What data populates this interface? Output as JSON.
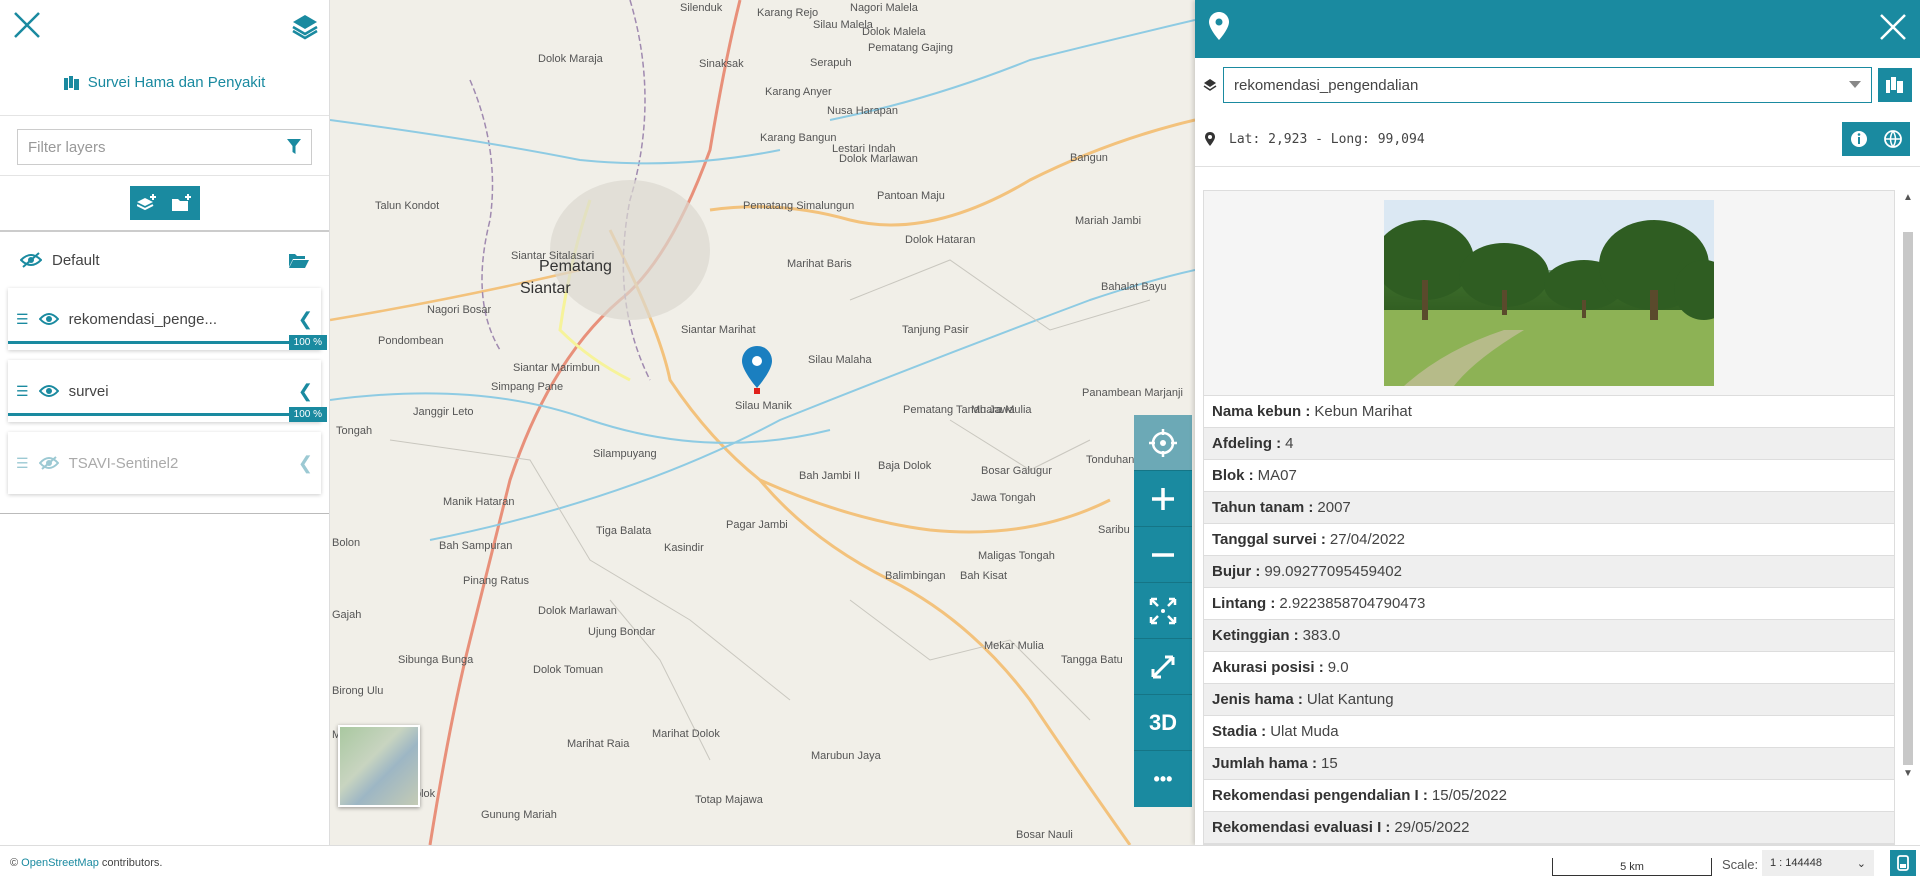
{
  "left_panel": {
    "title": "Survei Hama dan Penyakit",
    "filter_placeholder": "Filter layers",
    "group_name": "Default",
    "layers": [
      {
        "name": "rekomendasi_penge...",
        "opacity": "100 %",
        "visible": true
      },
      {
        "name": "survei",
        "opacity": "100 %",
        "visible": true
      },
      {
        "name": "TSAVI-Sentinel2",
        "visible": false
      }
    ]
  },
  "map": {
    "places": [
      {
        "name": "Silenduk"
      },
      {
        "name": "Karang Rejo"
      },
      {
        "name": "Silau Malela"
      },
      {
        "name": "Nagori Malela"
      },
      {
        "name": "Dolok Malela"
      },
      {
        "name": "Pematang Gajing"
      },
      {
        "name": "Dolok Maraja"
      },
      {
        "name": "Sinaksak"
      },
      {
        "name": "Serapuh"
      },
      {
        "name": "Karang Anyer"
      },
      {
        "name": "Nusa Harapan"
      },
      {
        "name": "Karang Bangun"
      },
      {
        "name": "Lestari Indah"
      },
      {
        "name": "Dolok Marlawan"
      },
      {
        "name": "Bangun"
      },
      {
        "name": "Pantoan Maju"
      },
      {
        "name": "Talun Kondot"
      },
      {
        "name": "Pematang Simalungun"
      },
      {
        "name": "Mariah Jambi"
      },
      {
        "name": "Siantar Sitalasari"
      },
      {
        "name": "Pematang"
      },
      {
        "name": "Siantar"
      },
      {
        "name": "Marihat Baris"
      },
      {
        "name": "Dolok Hataran"
      },
      {
        "name": "Nagori Bosar"
      },
      {
        "name": "Bahalat Bayu"
      },
      {
        "name": "Siantar Marihat"
      },
      {
        "name": "Tanjung Pasir"
      },
      {
        "name": "Pondombean"
      },
      {
        "name": "Silau Malaha"
      },
      {
        "name": "Panambean Marjanji"
      },
      {
        "name": "Siantar Marimbun"
      },
      {
        "name": "Simpang Pane"
      },
      {
        "name": "Silau Manik"
      },
      {
        "name": "Janggir Leto"
      },
      {
        "name": "Pematang Tanah Jawa"
      },
      {
        "name": "Muara Mulia"
      },
      {
        "name": "Tonduhan"
      },
      {
        "name": "Silampuyang"
      },
      {
        "name": "Baja Dolok"
      },
      {
        "name": "Bosar Galugur"
      },
      {
        "name": "Bah Jambi II"
      },
      {
        "name": "Manik Hataran"
      },
      {
        "name": "Jawa Tongah"
      },
      {
        "name": "Tiga Balata"
      },
      {
        "name": "Pagar Jambi"
      },
      {
        "name": "Saribu"
      },
      {
        "name": "Bah Sampuran"
      },
      {
        "name": "Kasindir"
      },
      {
        "name": "Maligas Tongah"
      },
      {
        "name": "Balimbingan"
      },
      {
        "name": "Bah Kisat"
      },
      {
        "name": "Pinang Ratus"
      },
      {
        "name": "Dolok Marlawan"
      },
      {
        "name": "Ujung Bondar"
      },
      {
        "name": "Sibunga Bunga"
      },
      {
        "name": "Dolok Tomuan"
      },
      {
        "name": "Mekar Mulia"
      },
      {
        "name": "Tangga Batu"
      },
      {
        "name": "Marihat Raia"
      },
      {
        "name": "Marihat Dolok"
      },
      {
        "name": "Marubun Jaya"
      },
      {
        "name": "Totap Majawa"
      },
      {
        "name": "Gunung Mariah"
      },
      {
        "name": "Bosar Nauli"
      },
      {
        "name": "Tongah"
      },
      {
        "name": "Bolon"
      },
      {
        "name": "Gajah"
      },
      {
        "name": "Birong Ulu"
      },
      {
        "name": "olok"
      },
      {
        "name": "Marimbun"
      }
    ],
    "controls": [
      "locate",
      "zoom-in",
      "zoom-out",
      "fit",
      "fullscreen",
      "3D",
      "more"
    ],
    "control_3d_label": "3D",
    "more_label": "•••"
  },
  "right_panel": {
    "layer_select": "rekomendasi_pengendalian",
    "coords": "Lat: 2,923 - Long: 99,094",
    "attributes": [
      {
        "label": "Nama kebun :",
        "value": "Kebun Marihat"
      },
      {
        "label": "Afdeling :",
        "value": "4"
      },
      {
        "label": "Blok :",
        "value": "MA07"
      },
      {
        "label": "Tahun tanam :",
        "value": "2007"
      },
      {
        "label": "Tanggal survei :",
        "value": "27/04/2022"
      },
      {
        "label": "Bujur :",
        "value": "99.09277095459402"
      },
      {
        "label": "Lintang :",
        "value": "2.9223858704790473"
      },
      {
        "label": "Ketinggian :",
        "value": "383.0"
      },
      {
        "label": "Akurasi posisi :",
        "value": "9.0"
      },
      {
        "label": "Jenis hama :",
        "value": "Ulat Kantung"
      },
      {
        "label": "Stadia :",
        "value": "Ulat Muda"
      },
      {
        "label": "Jumlah hama :",
        "value": "15"
      },
      {
        "label": "Rekomendasi pengendalian I :",
        "value": "15/05/2022"
      },
      {
        "label": "Rekomendasi evaluasi I :",
        "value": "29/05/2022"
      }
    ]
  },
  "footer": {
    "copyright": "©",
    "osm_link": "OpenStreetMap",
    "contributors": "contributors.",
    "scale_bar": "5 km",
    "scale_label": "Scale:",
    "scale_value": "1 : 144448"
  },
  "colors": {
    "accent": "#1a8aa0"
  }
}
